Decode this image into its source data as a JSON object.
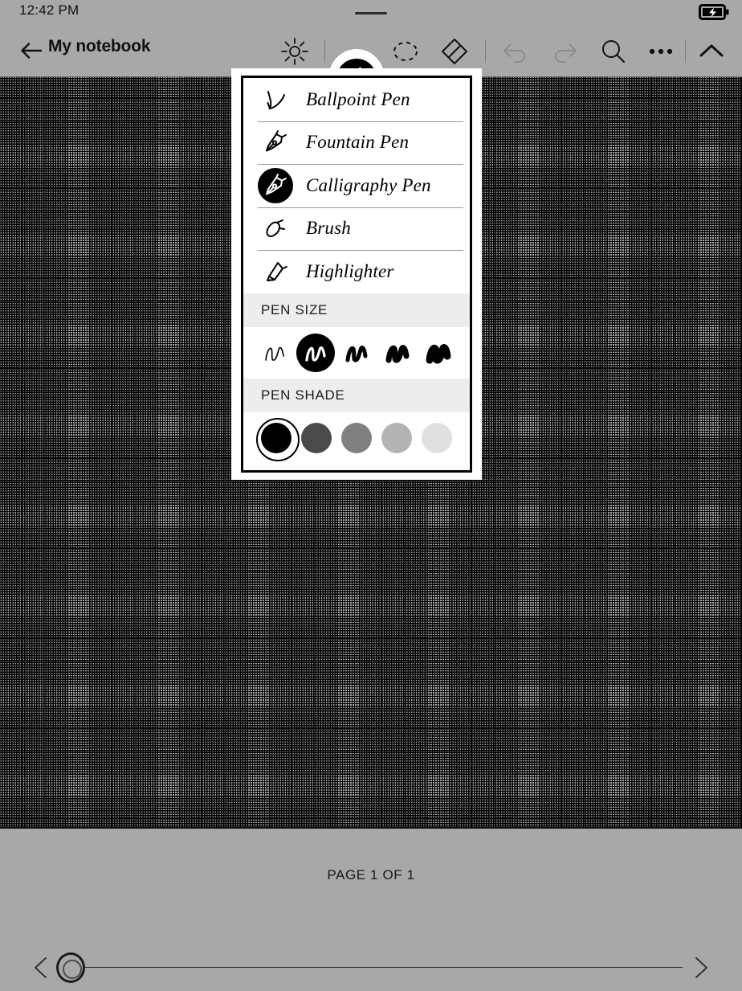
{
  "status": {
    "time": "12:42 PM",
    "battery_icon": "battery-charging-icon",
    "notch_icon": "notch-indicator"
  },
  "toolbar": {
    "back_icon": "arrow-left-icon",
    "title": "My notebook",
    "tools": [
      {
        "name": "brightness-tool",
        "icon": "sun-icon",
        "selected": false,
        "enabled": true
      },
      {
        "name": "pen-tool",
        "icon": "pen-nib-icon",
        "selected": true,
        "enabled": true
      },
      {
        "name": "lasso-select-tool",
        "icon": "lasso-icon",
        "selected": false,
        "enabled": true
      },
      {
        "name": "eraser-tool",
        "icon": "eraser-icon",
        "selected": false,
        "enabled": true
      },
      {
        "name": "undo-button",
        "icon": "undo-icon",
        "selected": false,
        "enabled": false
      },
      {
        "name": "redo-button",
        "icon": "redo-icon",
        "selected": false,
        "enabled": false
      },
      {
        "name": "search-button",
        "icon": "search-icon",
        "selected": false,
        "enabled": true
      },
      {
        "name": "more-button",
        "icon": "ellipsis-icon",
        "selected": false,
        "enabled": true
      },
      {
        "name": "collapse-button",
        "icon": "chevron-up-icon",
        "selected": false,
        "enabled": true
      }
    ]
  },
  "pen_popup": {
    "pen_types": [
      {
        "label": "Ballpoint Pen",
        "icon": "ballpoint-pen-icon",
        "selected": false
      },
      {
        "label": "Fountain Pen",
        "icon": "fountain-pen-icon",
        "selected": false
      },
      {
        "label": "Calligraphy Pen",
        "icon": "calligraphy-pen-icon",
        "selected": true
      },
      {
        "label": "Brush",
        "icon": "brush-icon",
        "selected": false
      },
      {
        "label": "Highlighter",
        "icon": "highlighter-icon",
        "selected": false
      }
    ],
    "pen_size": {
      "header": "PEN SIZE",
      "options": [
        {
          "name": "size-1",
          "stroke_width": 1.6,
          "selected": false
        },
        {
          "name": "size-2",
          "stroke_width": 3.2,
          "selected": true
        },
        {
          "name": "size-3",
          "stroke_width": 5.0,
          "selected": false
        },
        {
          "name": "size-4",
          "stroke_width": 7.0,
          "selected": false
        },
        {
          "name": "size-5",
          "stroke_width": 9.0,
          "selected": false
        }
      ]
    },
    "pen_shade": {
      "header": "PEN SHADE",
      "options": [
        {
          "name": "shade-black",
          "color": "#000000",
          "selected": true
        },
        {
          "name": "shade-dark-gray",
          "color": "#4a4a4a",
          "selected": false
        },
        {
          "name": "shade-mid-gray",
          "color": "#808080",
          "selected": false
        },
        {
          "name": "shade-light-gray",
          "color": "#b4b4b4",
          "selected": false
        },
        {
          "name": "shade-pale-gray",
          "color": "#e0e0e0",
          "selected": false
        }
      ]
    }
  },
  "footer": {
    "page_indicator": "PAGE 1 OF 1",
    "prev_icon": "chevron-left-icon",
    "next_icon": "chevron-right-icon",
    "slider_handle": "page-slider-handle"
  },
  "colors": {
    "background": "#a8a8a8",
    "accent": "#000000",
    "panel": "#ffffff",
    "section_header_bg": "#ededed"
  }
}
